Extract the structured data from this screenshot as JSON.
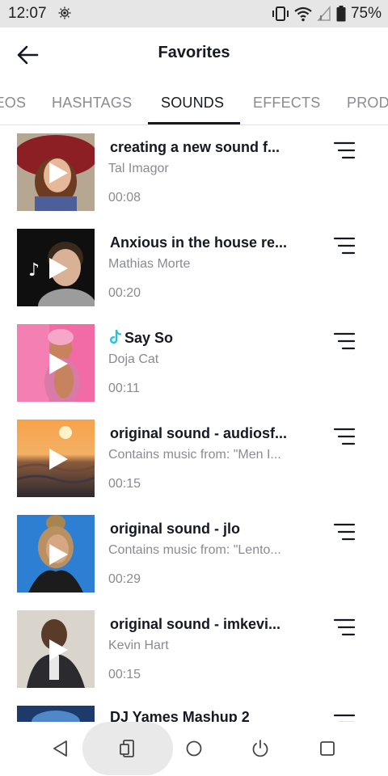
{
  "status_bar": {
    "time": "12:07",
    "battery": "75%"
  },
  "header": {
    "title": "Favorites"
  },
  "tabs": [
    {
      "label": "VIDEOS",
      "active": false
    },
    {
      "label": "HASHTAGS",
      "active": false
    },
    {
      "label": "SOUNDS",
      "active": true
    },
    {
      "label": "EFFECTS",
      "active": false
    },
    {
      "label": "PRODUCTS",
      "active": false
    }
  ],
  "sounds": [
    {
      "title": "creating a new sound f...",
      "artist": "Tal Imagor",
      "duration": "00:08"
    },
    {
      "title": "Anxious in the house re...",
      "artist": "Mathias Morte",
      "duration": "00:20"
    },
    {
      "title": "Say So",
      "artist": "Doja Cat",
      "duration": "00:11",
      "original": true
    },
    {
      "title": "original sound - audiosf...",
      "artist": "Contains music from: \"Men I...",
      "duration": "00:15"
    },
    {
      "title": "original sound - jlo",
      "artist": "Contains music from: \"Lento...",
      "duration": "00:29"
    },
    {
      "title": "original sound - imkevi...",
      "artist": "Kevin Hart",
      "duration": "00:15"
    },
    {
      "title": "DJ Yames Mashup 2",
      "artist": "",
      "duration": ""
    }
  ],
  "colors": {
    "accent_note": "#25c3d9",
    "text_primary": "#161823",
    "text_secondary": "#8a8b91"
  }
}
